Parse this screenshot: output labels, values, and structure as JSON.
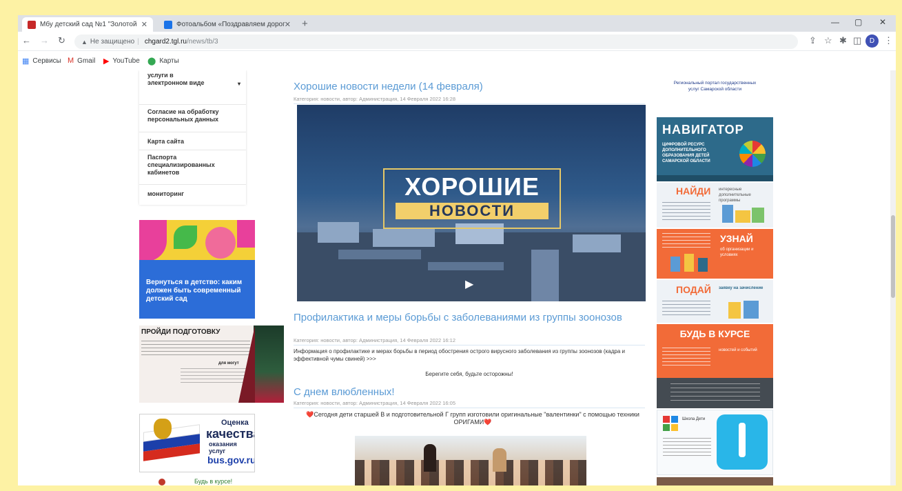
{
  "browser": {
    "tabs": [
      {
        "title": "Мбу детский сад №1 \"Золотой",
        "favicon_color": "#c62828",
        "active": true
      },
      {
        "title": "Фотоальбом «Поздравляем дорог",
        "favicon_color": "#1a73e8",
        "active": false
      }
    ],
    "new_tab": "+",
    "window_controls": {
      "minimize": "—",
      "restore": "▢",
      "close": "✕"
    },
    "nav": {
      "back": "←",
      "forward": "→",
      "reload": "↻"
    },
    "url": {
      "security": "Не защищено",
      "host": "chgard2.tgl.ru",
      "path": "/news/tb/3"
    },
    "profile_initial": "D",
    "bookmarks": [
      {
        "label": "Сервисы",
        "icon": "apps-icon",
        "color": "#4285f4"
      },
      {
        "label": "Gmail",
        "icon": "gmail-icon",
        "color": "#d93025"
      },
      {
        "label": "YouTube",
        "icon": "youtube-icon",
        "color": "#ff0000"
      },
      {
        "label": "Карты",
        "icon": "maps-icon",
        "color": "#34a853"
      }
    ]
  },
  "left_menu": [
    {
      "label": "услуги в электронном виде",
      "has_caret": true
    },
    {
      "label": "Согласие на обработку персональных данных",
      "has_caret": false
    },
    {
      "label": "Карта сайта",
      "has_caret": false
    },
    {
      "label": "Паспорта специализированных кабинетов",
      "has_caret": false
    },
    {
      "label": "мониторинг",
      "has_caret": false
    }
  ],
  "left_banners": {
    "childhood": {
      "text": "Вернуться в детство: каким должен быть современный детский сад"
    },
    "training": {
      "title": "ПРОЙДИ ПОДГОТОВКУ",
      "sub": "для могут"
    },
    "busgov": {
      "line1": "Оценка",
      "line2": "качества",
      "line3": "оказания услуг",
      "site": "bus.gov.ru"
    },
    "bottom": {
      "text": "Будь в курсе!"
    }
  },
  "articles": [
    {
      "title": "Хорошие новости недели (14 февраля)",
      "meta": "Категория: новости, автор: Администрация, 14 Февраля 2022 16:28"
    },
    {
      "title": "Профилактика и меры борьбы с заболеваниями из группы зоонозов",
      "meta": "Категория: новости, автор: Администрация, 14 Февраля 2022 16:12",
      "text": "Информация о профилактике и мерах борьбы в период обострения острого вирусного заболевания из группы зоонозов (кадра и эффективной чумы свиней) >>>",
      "closing": "Берегите себя, будьте осторожны!"
    },
    {
      "title": "С днем влюбленных!",
      "meta": "Категория: новости, автор: Администрация, 14 Февраля 2022 16:05",
      "text": "❤️Сегодня дети старшей В и подготовительной Г групп изготовили оригинальные \"валентинки\" с помощью техники ОРИГАМИ❤️"
    }
  ],
  "news_image": {
    "line1": "ХОРОШИЕ",
    "line2": "НОВОСТИ",
    "play_icon": "▶"
  },
  "right_column": {
    "gosuslugi": "Региональный портал государственных услуг Самарской области",
    "navigator": {
      "title": "НАВИГАТОР",
      "sub": "ЦИФРОВОЙ РЕСУРС ДОПОЛНИТЕЛЬНОГО ОБРАЗОВАНИЯ ДЕТЕЙ САМАРСКОЙ ОБЛАСТИ"
    },
    "naydi": {
      "title": "НАЙДИ",
      "sub": "интересные дополнительные программы"
    },
    "uznai": {
      "title": "УЗНАЙ",
      "sub": "об организации и условиях"
    },
    "podai": {
      "title": "ПОДАЙ",
      "sub": "заявку на зачисление"
    },
    "bud_v_kurse": {
      "title": "БУДЬ В КУРСЕ",
      "sub": "новостей и событий"
    },
    "vaccine": {
      "title": "Школа Дети"
    }
  },
  "colors": {
    "accent_link": "#5b9bd5",
    "navigator_bg": "#2d6a8a",
    "orange": "#f26b38",
    "yellow_frame": "#fdf2a4"
  }
}
